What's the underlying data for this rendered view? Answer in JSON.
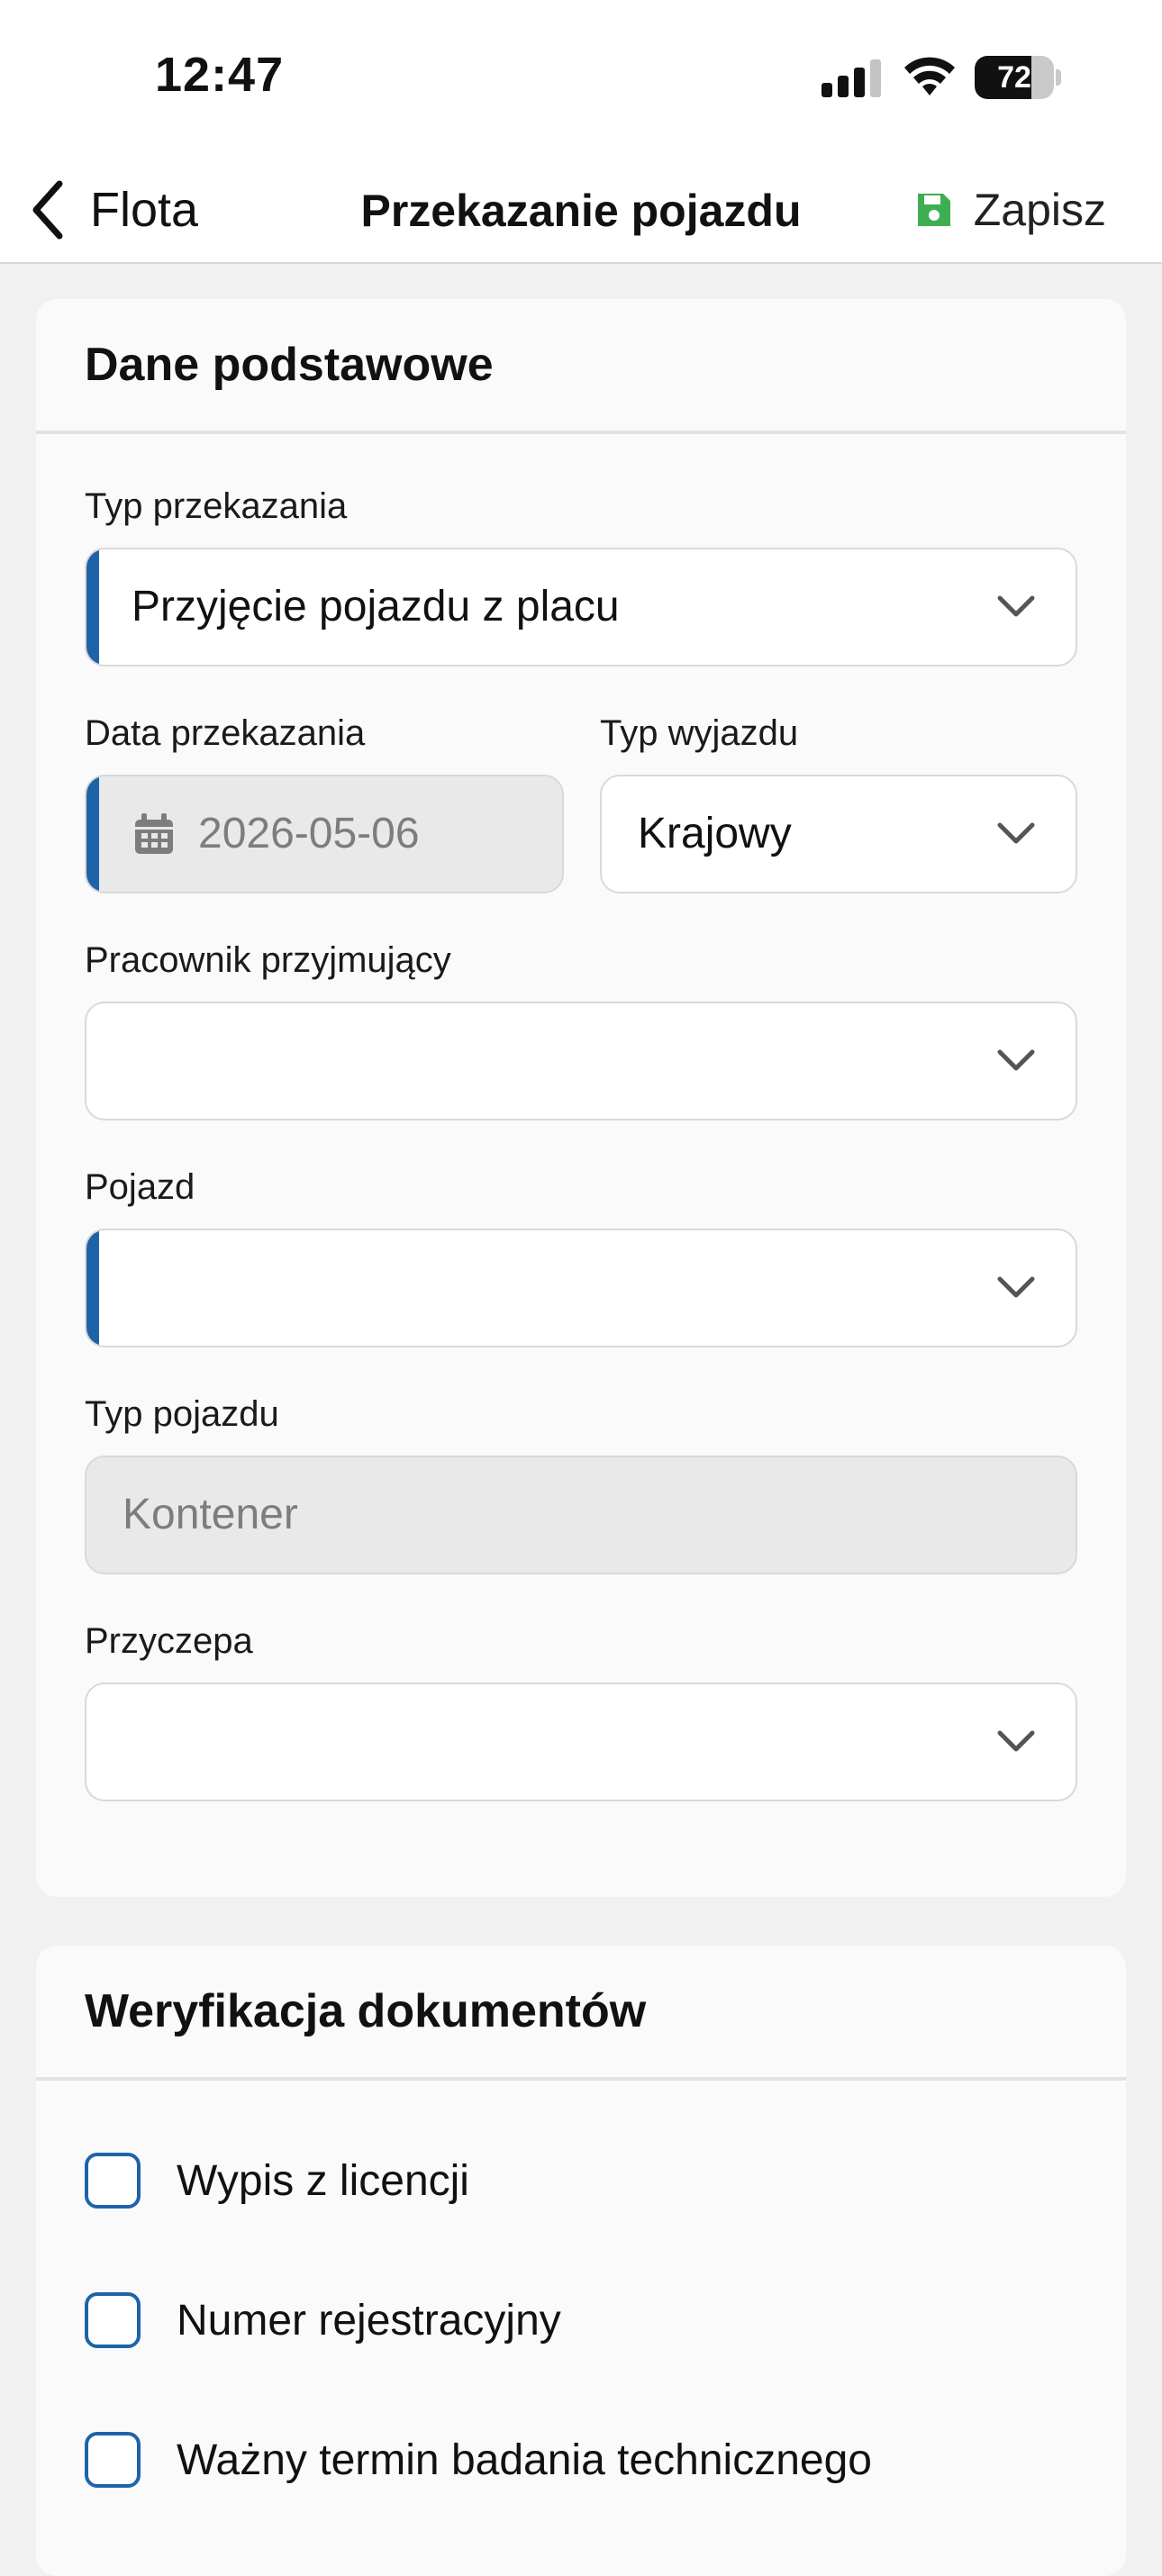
{
  "status_bar": {
    "time": "12:47",
    "battery": "72",
    "battery_level": 0.72,
    "icons": [
      "signal-icon",
      "wifi-icon",
      "battery-icon"
    ]
  },
  "nav": {
    "back_label": "Flota",
    "title": "Przekazanie pojazdu",
    "save_label": "Zapisz",
    "save_icon": "floppy-disk-icon",
    "save_icon_color": "#3fae52"
  },
  "colors": {
    "accent": "#1e63a8",
    "card_background": "#fafafa",
    "page_background": "#f1f1f1"
  },
  "basic_section": {
    "title": "Dane podstawowe",
    "transfer_type": {
      "label": "Typ przekazania",
      "value": "Przyjęcie pojazdu z placu"
    },
    "transfer_date": {
      "label": "Data przekazania",
      "value": "2026-05-06"
    },
    "trip_type": {
      "label": "Typ wyjazdu",
      "value": "Krajowy"
    },
    "receiving_employee": {
      "label": "Pracownik przyjmujący",
      "value": ""
    },
    "vehicle": {
      "label": "Pojazd",
      "value": ""
    },
    "vehicle_type": {
      "label": "Typ pojazdu",
      "value": "Kontener"
    },
    "trailer": {
      "label": "Przyczepa",
      "value": ""
    }
  },
  "documents_section": {
    "title": "Weryfikacja dokumentów",
    "items": [
      {
        "label": "Wypis z licencji",
        "checked": false
      },
      {
        "label": "Numer rejestracyjny",
        "checked": false
      },
      {
        "label": "Ważny termin badania technicznego",
        "checked": false
      }
    ]
  }
}
